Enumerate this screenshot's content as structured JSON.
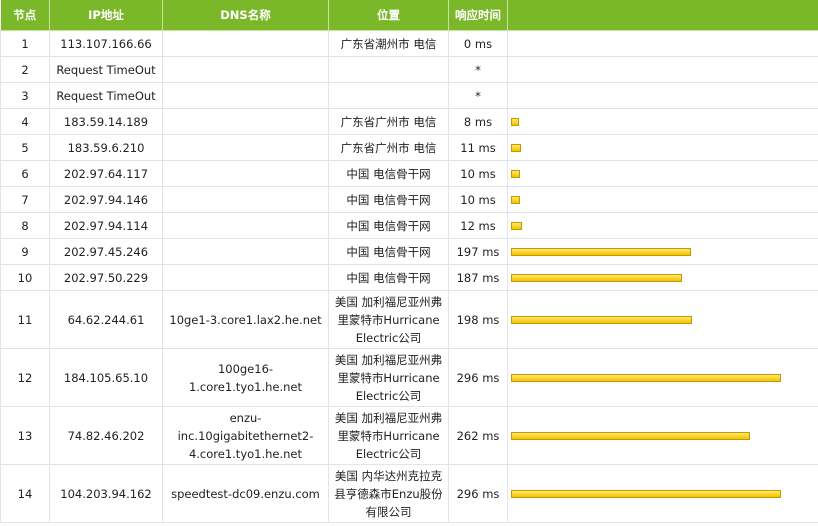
{
  "header": {
    "hop": "节点",
    "ip": "IP地址",
    "dns": "DNS名称",
    "location": "位置",
    "time": "响应时间"
  },
  "rows": [
    {
      "hop": "1",
      "ip": "113.107.166.66",
      "dns": "",
      "location": "广东省潮州市 电信",
      "time": "0 ms",
      "ms": 0
    },
    {
      "hop": "2",
      "ip": "Request TimeOut",
      "dns": "",
      "location": "",
      "time": "*",
      "ms": null
    },
    {
      "hop": "3",
      "ip": "Request TimeOut",
      "dns": "",
      "location": "",
      "time": "*",
      "ms": null
    },
    {
      "hop": "4",
      "ip": "183.59.14.189",
      "dns": "",
      "location": "广东省广州市 电信",
      "time": "8 ms",
      "ms": 8
    },
    {
      "hop": "5",
      "ip": "183.59.6.210",
      "dns": "",
      "location": "广东省广州市 电信",
      "time": "11 ms",
      "ms": 11
    },
    {
      "hop": "6",
      "ip": "202.97.64.117",
      "dns": "",
      "location": "中国 电信骨干网",
      "time": "10 ms",
      "ms": 10
    },
    {
      "hop": "7",
      "ip": "202.97.94.146",
      "dns": "",
      "location": "中国 电信骨干网",
      "time": "10 ms",
      "ms": 10
    },
    {
      "hop": "8",
      "ip": "202.97.94.114",
      "dns": "",
      "location": "中国 电信骨干网",
      "time": "12 ms",
      "ms": 12
    },
    {
      "hop": "9",
      "ip": "202.97.45.246",
      "dns": "",
      "location": "中国 电信骨干网",
      "time": "197 ms",
      "ms": 197
    },
    {
      "hop": "10",
      "ip": "202.97.50.229",
      "dns": "",
      "location": "中国 电信骨干网",
      "time": "187 ms",
      "ms": 187
    },
    {
      "hop": "11",
      "ip": "64.62.244.61",
      "dns": "10ge1-3.core1.lax2.he.net",
      "location": "美国 加利福尼亚州弗里蒙特市Hurricane Electric公司",
      "time": "198 ms",
      "ms": 198
    },
    {
      "hop": "12",
      "ip": "184.105.65.10",
      "dns": "100ge16-1.core1.tyo1.he.net",
      "location": "美国 加利福尼亚州弗里蒙特市Hurricane Electric公司",
      "time": "296 ms",
      "ms": 296
    },
    {
      "hop": "13",
      "ip": "74.82.46.202",
      "dns": "enzu-inc.10gigabitethernet2-4.core1.tyo1.he.net",
      "location": "美国 加利福尼亚州弗里蒙特市Hurricane Electric公司",
      "time": "262 ms",
      "ms": 262
    },
    {
      "hop": "14",
      "ip": "104.203.94.162",
      "dns": "speedtest-dc09.enzu.com",
      "location": "美国 内华达州克拉克县亨德森市Enzu股份有限公司",
      "time": "296 ms",
      "ms": 296
    }
  ],
  "bar_color": "#f5cc00"
}
